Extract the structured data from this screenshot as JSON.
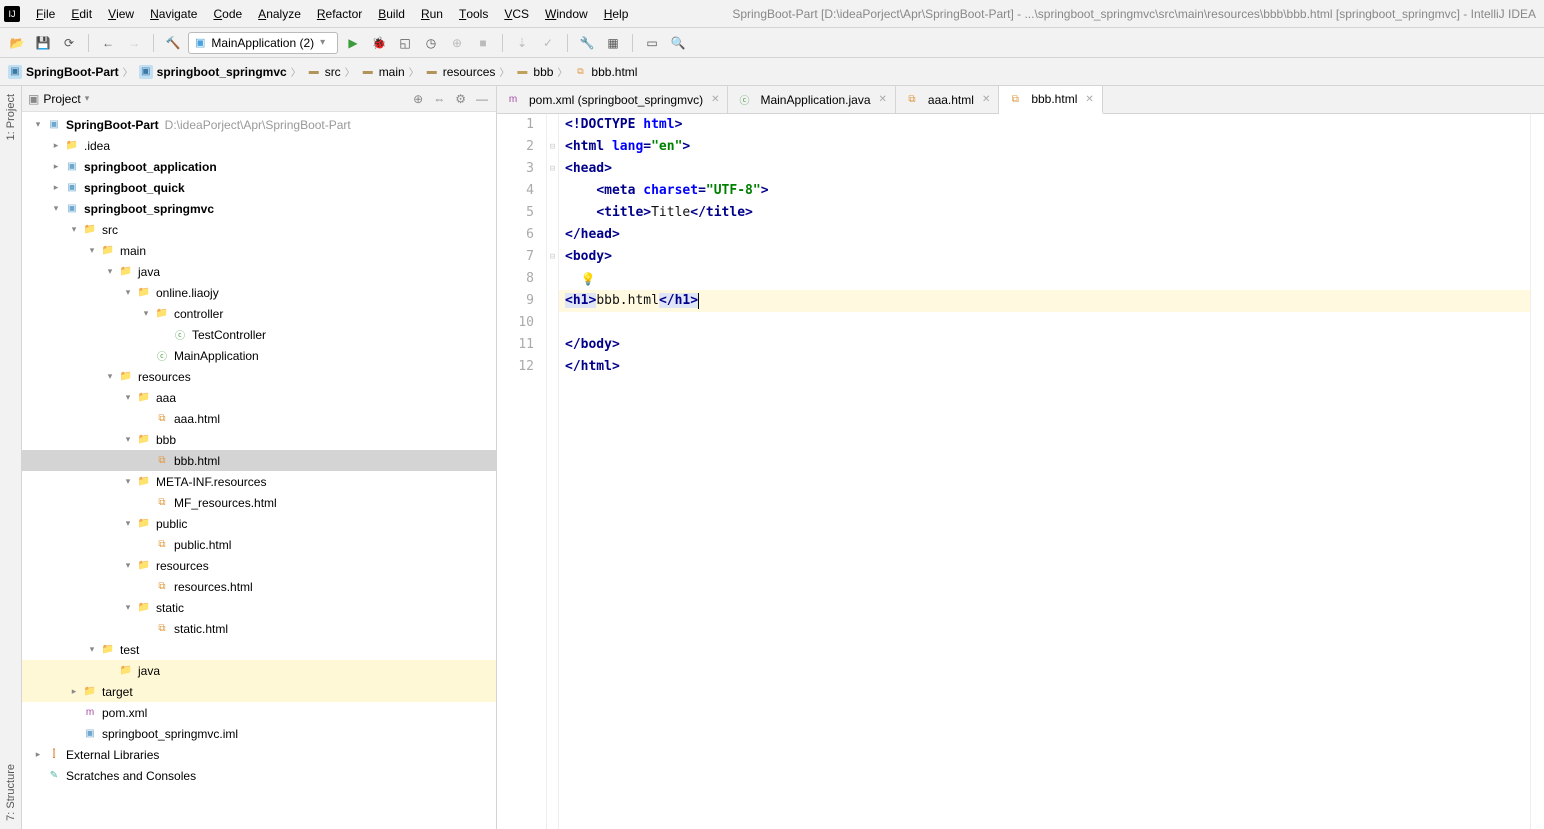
{
  "window_title": "SpringBoot-Part [D:\\ideaPorject\\Apr\\SpringBoot-Part] - ...\\springboot_springmvc\\src\\main\\resources\\bbb\\bbb.html [springboot_springmvc] - IntelliJ IDEA",
  "menu": [
    "File",
    "Edit",
    "View",
    "Navigate",
    "Code",
    "Analyze",
    "Refactor",
    "Build",
    "Run",
    "Tools",
    "VCS",
    "Window",
    "Help"
  ],
  "run_config": "MainApplication (2)",
  "breadcrumbs": [
    {
      "icon": "mod",
      "label": "SpringBoot-Part"
    },
    {
      "icon": "mod",
      "label": "springboot_springmvc"
    },
    {
      "icon": "fld",
      "label": "src"
    },
    {
      "icon": "fld",
      "label": "main"
    },
    {
      "icon": "fld",
      "label": "resources"
    },
    {
      "icon": "dir",
      "label": "bbb"
    },
    {
      "icon": "html",
      "label": "bbb.html"
    }
  ],
  "project_title": "Project",
  "tree": [
    {
      "d": 0,
      "a": "v",
      "i": "mod",
      "l": "SpringBoot-Part",
      "ext": "D:\\ideaPorject\\Apr\\SpringBoot-Part",
      "bold": true
    },
    {
      "d": 1,
      "a": ">",
      "i": "dir",
      "l": ".idea"
    },
    {
      "d": 1,
      "a": ">",
      "i": "mod",
      "l": "springboot_application",
      "bold": true
    },
    {
      "d": 1,
      "a": ">",
      "i": "mod",
      "l": "springboot_quick",
      "bold": true
    },
    {
      "d": 1,
      "a": "v",
      "i": "mod",
      "l": "springboot_springmvc",
      "bold": true
    },
    {
      "d": 2,
      "a": "v",
      "i": "fld",
      "l": "src"
    },
    {
      "d": 3,
      "a": "v",
      "i": "fld",
      "l": "main"
    },
    {
      "d": 4,
      "a": "v",
      "i": "jfld",
      "l": "java"
    },
    {
      "d": 5,
      "a": "v",
      "i": "fld",
      "l": "online.liaojy"
    },
    {
      "d": 6,
      "a": "v",
      "i": "fld",
      "l": "controller"
    },
    {
      "d": 7,
      "a": "",
      "i": "cls",
      "l": "TestController"
    },
    {
      "d": 6,
      "a": "",
      "i": "cls",
      "l": "MainApplication"
    },
    {
      "d": 4,
      "a": "v",
      "i": "fld",
      "l": "resources"
    },
    {
      "d": 5,
      "a": "v",
      "i": "dir",
      "l": "aaa"
    },
    {
      "d": 6,
      "a": "",
      "i": "html",
      "l": "aaa.html"
    },
    {
      "d": 5,
      "a": "v",
      "i": "dir",
      "l": "bbb"
    },
    {
      "d": 6,
      "a": "",
      "i": "html",
      "l": "bbb.html",
      "sel": true
    },
    {
      "d": 5,
      "a": "v",
      "i": "dir",
      "l": "META-INF.resources"
    },
    {
      "d": 6,
      "a": "",
      "i": "html",
      "l": "MF_resources.html"
    },
    {
      "d": 5,
      "a": "v",
      "i": "dir",
      "l": "public"
    },
    {
      "d": 6,
      "a": "",
      "i": "html",
      "l": "public.html"
    },
    {
      "d": 5,
      "a": "v",
      "i": "dir",
      "l": "resources"
    },
    {
      "d": 6,
      "a": "",
      "i": "html",
      "l": "resources.html"
    },
    {
      "d": 5,
      "a": "v",
      "i": "dir",
      "l": "static"
    },
    {
      "d": 6,
      "a": "",
      "i": "html",
      "l": "static.html"
    },
    {
      "d": 3,
      "a": "v",
      "i": "fld",
      "l": "test"
    },
    {
      "d": 4,
      "a": "",
      "i": "jfld",
      "l": "java",
      "hl": true
    },
    {
      "d": 2,
      "a": ">",
      "i": "tgt",
      "l": "target",
      "hl": true
    },
    {
      "d": 2,
      "a": "",
      "i": "m",
      "l": "pom.xml"
    },
    {
      "d": 2,
      "a": "",
      "i": "mod",
      "l": "springboot_springmvc.iml"
    },
    {
      "d": 0,
      "a": ">",
      "i": "lib",
      "l": "External Libraries"
    },
    {
      "d": 0,
      "a": "",
      "i": "scr",
      "l": "Scratches and Consoles"
    }
  ],
  "tabs": [
    {
      "icon": "m",
      "label": "pom.xml (springboot_springmvc)",
      "active": false
    },
    {
      "icon": "cls",
      "label": "MainApplication.java",
      "active": false
    },
    {
      "icon": "html",
      "label": "aaa.html",
      "active": false
    },
    {
      "icon": "html",
      "label": "bbb.html",
      "active": true
    }
  ],
  "code_lines": [
    1,
    2,
    3,
    4,
    5,
    6,
    7,
    8,
    9,
    10,
    11,
    12
  ],
  "code": {
    "l1": {
      "doctype": "<!DOCTYPE ",
      "html": "html",
      "end": ">"
    },
    "l2": {
      "p1": "<",
      "t1": "html ",
      "a1": "lang",
      "eq": "=",
      "v1": "\"en\"",
      "p2": ">"
    },
    "l3": {
      "p1": "<",
      "t1": "head",
      "p2": ">"
    },
    "l4": {
      "ind": "    ",
      "p1": "<",
      "t1": "meta ",
      "a1": "charset",
      "eq": "=",
      "v1": "\"UTF-8\"",
      "p2": ">"
    },
    "l5": {
      "ind": "    ",
      "p1": "<",
      "t1": "title",
      "p2": ">",
      "txt": "Title",
      "p3": "</",
      "t2": "title",
      "p4": ">"
    },
    "l6": {
      "p1": "</",
      "t1": "head",
      "p2": ">"
    },
    "l7": {
      "p1": "<",
      "t1": "body",
      "p2": ">"
    },
    "l9_open": "<h1>",
    "l9_txt": "bbb.html",
    "l9_close": "</h1>",
    "l11": {
      "p1": "</",
      "t1": "body",
      "p2": ">"
    },
    "l12": {
      "p1": "</",
      "t1": "html",
      "p2": ">"
    }
  },
  "sidetabs": {
    "project": "1: Project",
    "structure": "7: Structure"
  }
}
